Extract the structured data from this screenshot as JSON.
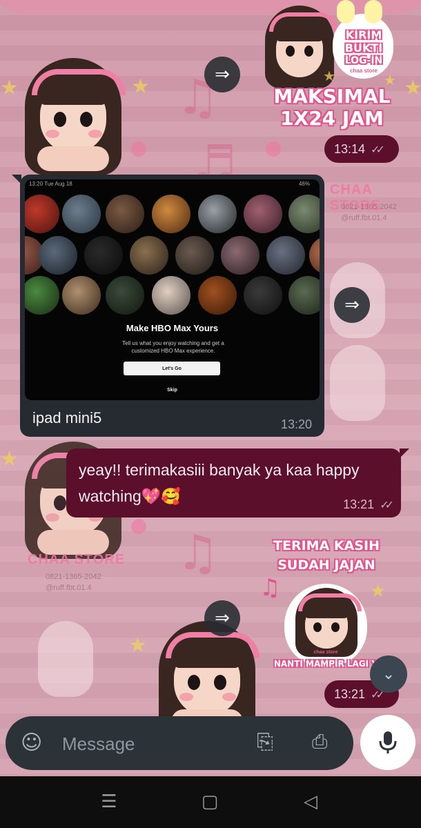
{
  "chat": {
    "sticker1": {
      "line1": "KIRIM",
      "line2": "BUKTI",
      "line3": "LOG-IN",
      "line4": "MAKSIMAL",
      "line5": "1X24 JAM",
      "brand": "chaa store",
      "time": "13:14"
    },
    "incoming": {
      "screenshot": {
        "status_time": "13:20 Tue Aug 18",
        "status_battery": "46%",
        "title": "Make HBO Max Yours",
        "subtitle": "Tell us what you enjoy watching and get a customized HBO Max experience.",
        "button": "Let's Go",
        "skip": "Skip"
      },
      "caption": "ipad mini5",
      "time": "13:20"
    },
    "outgoing": {
      "text": "yeay!! terimakasiii banyak ya kaa happy watching💖🥰",
      "time": "13:21"
    },
    "sticker2": {
      "line1": "TERIMA KASIH",
      "line2": "SUDAH JAJAN",
      "line3": "NANTI MAMPIR LAGI YA",
      "brand": "chaa store",
      "time": "13:21"
    }
  },
  "wallpaper": {
    "store": "CHAA STORE",
    "phone": "0821-1365-2042",
    "handle": "@ruff.fbt.01.4"
  },
  "composer": {
    "placeholder": "Message"
  },
  "icons": {
    "forward": "forward-icon",
    "sticker": "sticker-icon",
    "attach": "paperclip-icon",
    "camera": "camera-icon",
    "mic": "mic-icon",
    "scroll": "chevron-double-down-icon"
  },
  "colors": {
    "outgoing_bubble": "#5b0f2a",
    "incoming_bubble": "#262b31",
    "composer": "#2b3238"
  }
}
